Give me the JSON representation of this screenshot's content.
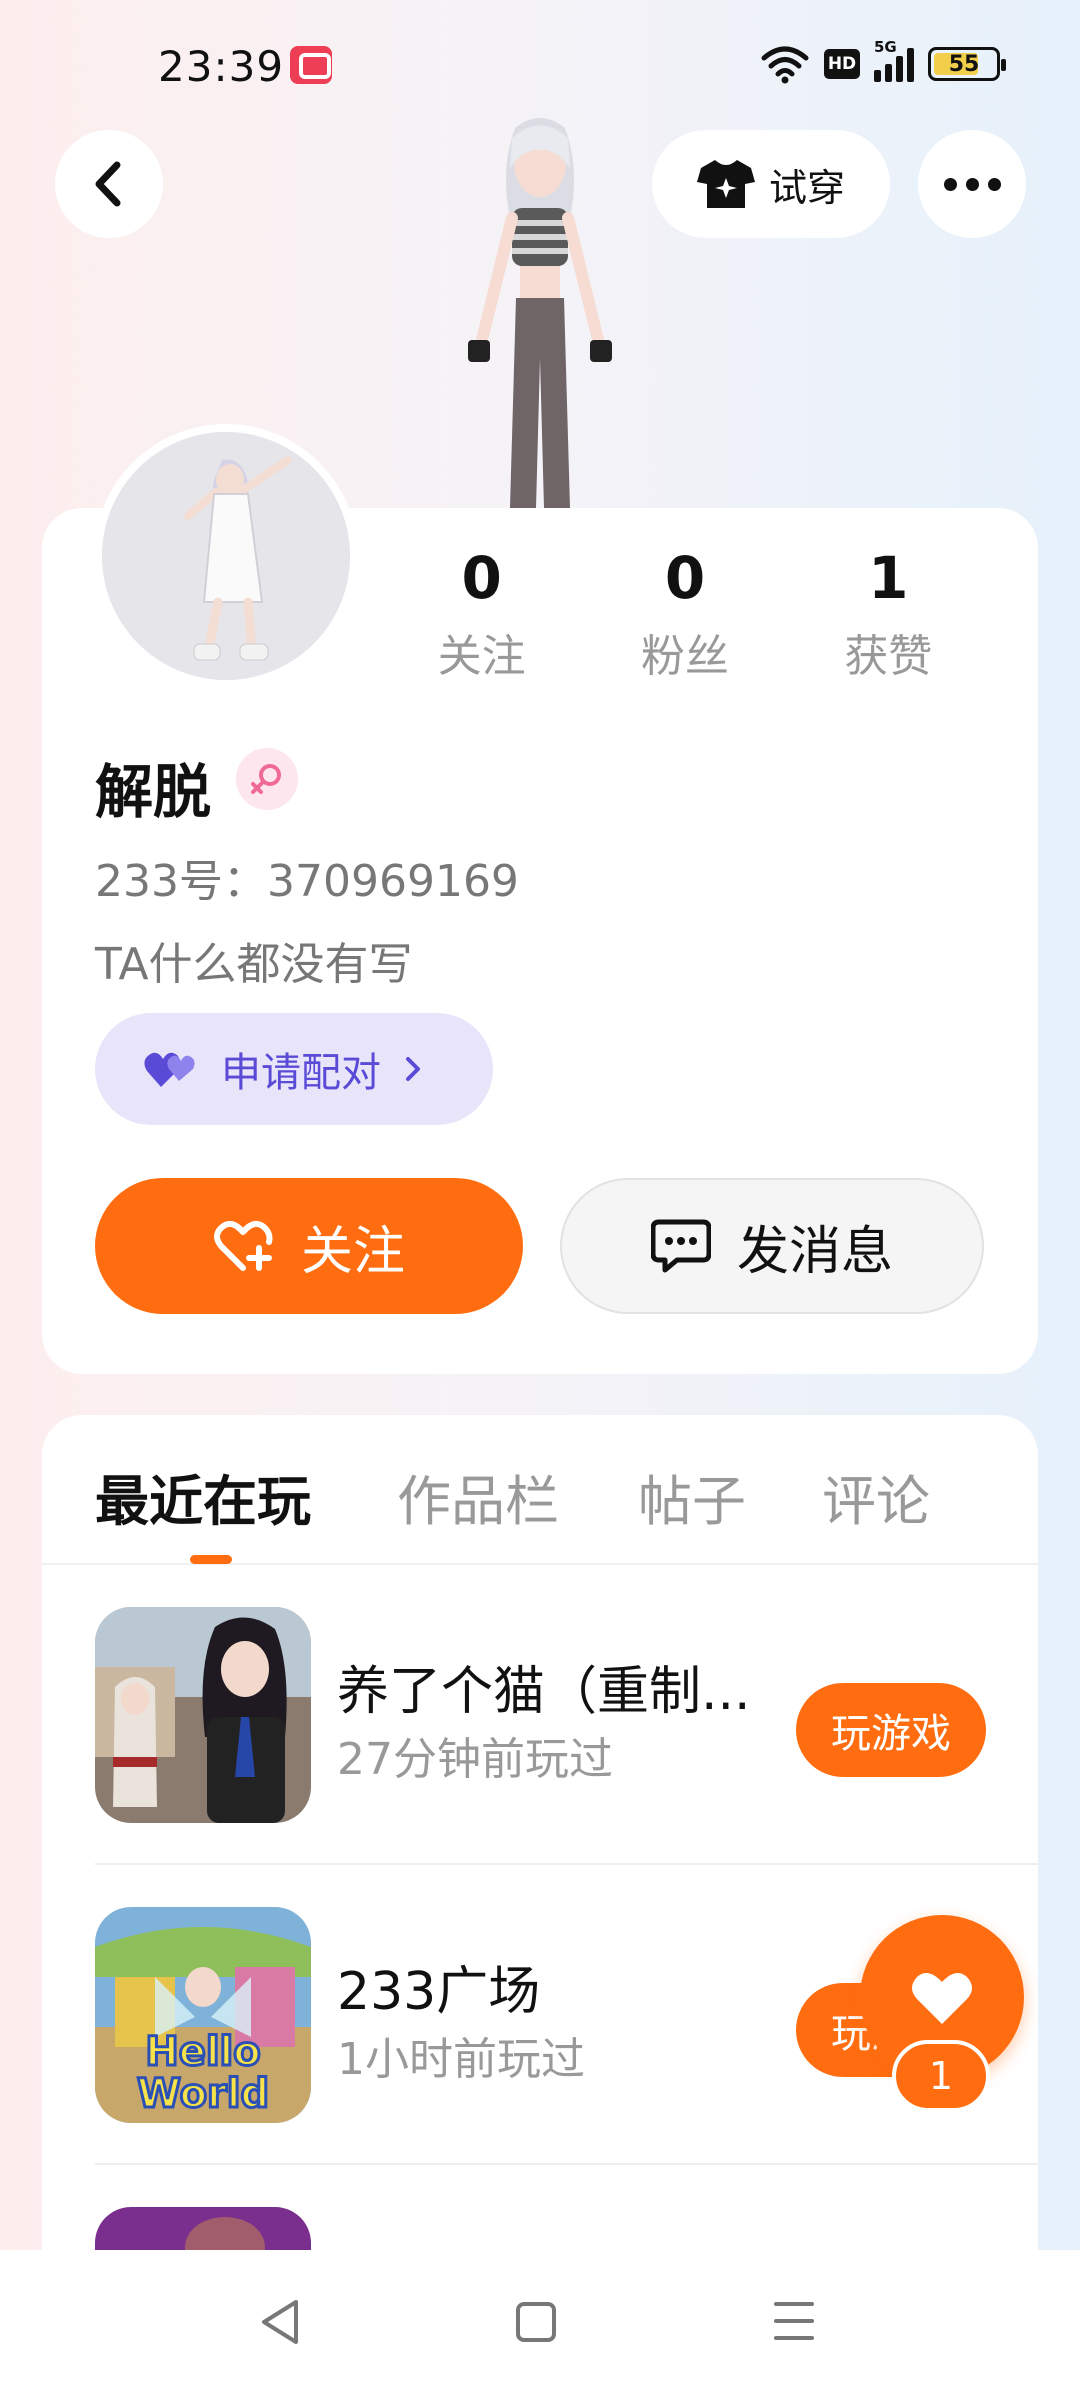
{
  "status_bar": {
    "time": "23:39",
    "network_label": "HD",
    "signal_label": "5G",
    "battery": "55"
  },
  "header": {
    "try_on_label": "试穿"
  },
  "profile": {
    "following_count": "0",
    "following_label": "关注",
    "followers_count": "0",
    "followers_label": "粉丝",
    "likes_count": "1",
    "likes_label": "获赞",
    "name": "解脱",
    "uid": "233号：370969169",
    "bio": "TA什么都没有写",
    "pair_label": "申请配对",
    "follow_label": "关注",
    "message_label": "发消息"
  },
  "tabs": [
    {
      "label": "最近在玩"
    },
    {
      "label": "作品栏"
    },
    {
      "label": "帖子"
    },
    {
      "label": "评论"
    }
  ],
  "games": [
    {
      "title": "养了个猫（重制...",
      "time": "27分钟前玩过",
      "action": "玩游戏"
    },
    {
      "title": "233广场",
      "time": "1小时前玩过",
      "action": "玩游戏",
      "thumb_text": "Hello World"
    }
  ],
  "floating_like": {
    "count": "1"
  },
  "colors": {
    "accent": "#ff6d10",
    "pair_bg": "#e8e5fb",
    "pair_text": "#5a4bd6"
  }
}
